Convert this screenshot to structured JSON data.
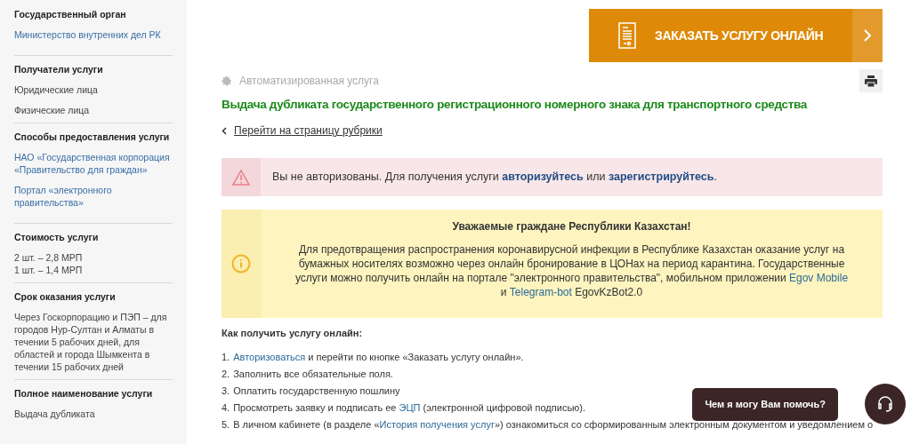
{
  "sidebar": {
    "sections": [
      {
        "title": "Государственный орган",
        "items": [
          {
            "kind": "link",
            "text": "Министерство внутренних дел РК"
          }
        ]
      },
      {
        "title": "Получатели услуги",
        "items": [
          {
            "kind": "text",
            "text": "Юридические лица"
          },
          {
            "kind": "text",
            "text": "Физические лица"
          }
        ]
      },
      {
        "title": "Способы предоставления услуги",
        "items": [
          {
            "kind": "link",
            "text": "НАО «Государственная корпорация «Правительство для граждан»"
          },
          {
            "kind": "link",
            "text": "Портал «электронного правительства»"
          }
        ]
      },
      {
        "title": "Стоимость услуги",
        "items": [
          {
            "kind": "text",
            "text": "2 шт. – 2,8 МРП"
          },
          {
            "kind": "text",
            "text": "1 шт. – 1,4 МРП"
          }
        ]
      },
      {
        "title": "Срок оказания услуги",
        "items": [
          {
            "kind": "text",
            "text": "Через Госкорпорацию и ПЭП – для городов Нур-Султан и Алматы в течении 5 рабочих дней, для областей и города Шымкента в течении 15 рабочих дней"
          }
        ]
      },
      {
        "title": "Полное наименование услуги",
        "items": [
          {
            "kind": "text",
            "text": "Выдача дубликата"
          }
        ]
      }
    ]
  },
  "order_button": {
    "label": "ЗАКАЗАТЬ УСЛУГУ ОНЛАЙН"
  },
  "service_type": "Автоматизированная услуга",
  "title": "Выдача дубликата государственного регистрационного номерного знака для транспортного средства",
  "back_link": "Перейти на страницу рубрики",
  "auth_alert": {
    "parts": [
      {
        "kind": "text",
        "text": "Вы не авторизованы. Для получения услуги "
      },
      {
        "kind": "link",
        "text": "авторизуйтесь"
      },
      {
        "kind": "text",
        "text": " или "
      },
      {
        "kind": "link",
        "text": "зарегистрируйтесь"
      },
      {
        "kind": "text",
        "text": "."
      }
    ]
  },
  "notice": {
    "heading": "Уважаемые граждане Республики Казахстан!",
    "parts": [
      {
        "kind": "text",
        "text": "Для предотвращения распространения коронавирусной инфекции в Республике Казахстан оказание услуг на бумажных носителях возможно через онлайн бронирование в ЦОНах на период карантина. Государственные услуги можно получить онлайн на портале \"электронного правительства\", мобильном приложении "
      },
      {
        "kind": "link",
        "text": "Egov Mobile"
      },
      {
        "kind": "text",
        "text": " и "
      },
      {
        "kind": "link",
        "text": "Telegram-bot"
      },
      {
        "kind": "text",
        "text": " EgovKzBot2.0"
      }
    ]
  },
  "howto": {
    "heading": "Как получить услугу онлайн:",
    "steps": [
      {
        "number": "1.",
        "parts": [
          {
            "kind": "link",
            "text": "Авторизоваться"
          },
          {
            "kind": "text",
            "text": " и перейти по кнопке «Заказать услугу онлайн»."
          }
        ]
      },
      {
        "number": "2.",
        "parts": [
          {
            "kind": "text",
            "text": "Заполнить все обязательные поля."
          }
        ]
      },
      {
        "number": "3.",
        "parts": [
          {
            "kind": "text",
            "text": "Оплатить государственную пошлину"
          }
        ]
      },
      {
        "number": "4.",
        "parts": [
          {
            "kind": "text",
            "text": "Просмотреть заявку и подписать ее "
          },
          {
            "kind": "link",
            "text": "ЭЦП"
          },
          {
            "kind": "text",
            "text": " (электронной цифровой подписью)."
          }
        ]
      },
      {
        "number": "5.",
        "parts": [
          {
            "kind": "text",
            "text": "В личном кабинете (в разделе «"
          },
          {
            "kind": "link",
            "text": "История получения услуг"
          },
          {
            "kind": "text",
            "text": "») ознакомиться со сформированным электронным документом и уведомлением о"
          }
        ]
      }
    ]
  },
  "chat": {
    "prompt": "Чем я могу Вам помочь?"
  }
}
